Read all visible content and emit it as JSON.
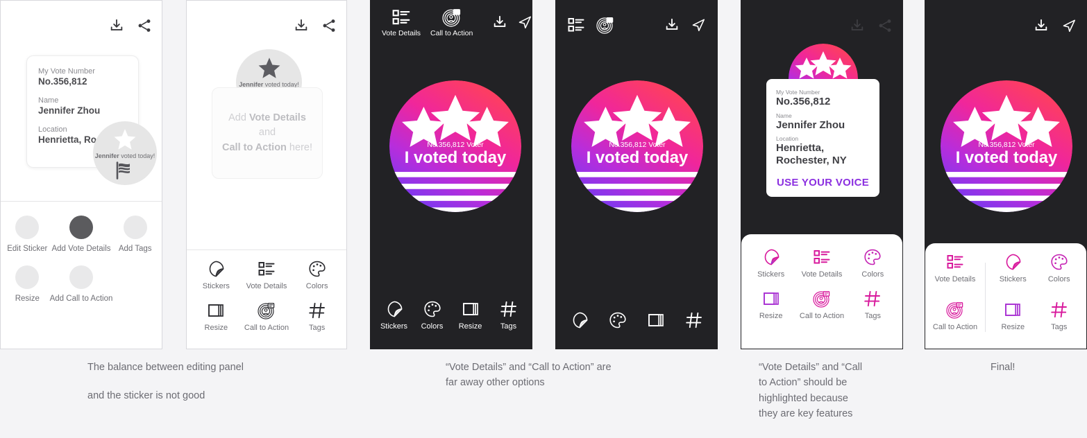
{
  "sticker": {
    "vote_line": "No.356,812 Voter",
    "headline": "I voted today",
    "small_headline": "I voted today"
  },
  "ghost_sticker": {
    "name": "Jennifer",
    "suffix": " voted today!"
  },
  "panel1": {
    "card": {
      "label_vote_number": "My Vote Number",
      "value_vote_number": "No.356,812",
      "label_name": "Name",
      "value_name": "Jennifer Zhou",
      "label_location": "Location",
      "value_location": "Henrietta, Rochester, NY"
    },
    "tools": [
      {
        "label": "Edit Sticker",
        "active": false
      },
      {
        "label": "Add Vote Details",
        "active": true
      },
      {
        "label": "Add Tags",
        "active": false
      },
      {
        "label": "Resize",
        "active": false
      },
      {
        "label": "Add Call to Action",
        "active": false
      }
    ],
    "topbar": [
      {
        "icon": "download-icon"
      },
      {
        "icon": "share-icon"
      }
    ]
  },
  "panel2": {
    "placeholder": {
      "line1_pre": "Add ",
      "line1_strong": "Vote Details",
      "line2": "and",
      "line3_strong": "Call to Action",
      "line3_post": " here!"
    },
    "tools": [
      {
        "label": "Stickers",
        "icon": "sticker-icon"
      },
      {
        "label": "Vote Details",
        "icon": "list-icon"
      },
      {
        "label": "Colors",
        "icon": "palette-icon"
      },
      {
        "label": "Resize",
        "icon": "resize-icon"
      },
      {
        "label": "Call to Action",
        "icon": "megaphone-icon"
      },
      {
        "label": "Tags",
        "icon": "hash-icon"
      }
    ]
  },
  "panel3": {
    "topbar_tools": [
      {
        "label": "Vote Details",
        "icon": "list-icon"
      },
      {
        "label": "Call to Action",
        "icon": "megaphone-icon"
      }
    ],
    "topbar_actions": [
      {
        "icon": "download-icon"
      },
      {
        "icon": "send-icon"
      }
    ],
    "tools": [
      {
        "label": "Stickers",
        "icon": "sticker-icon"
      },
      {
        "label": "Colors",
        "icon": "palette-icon"
      },
      {
        "label": "Resize",
        "icon": "resize-icon"
      },
      {
        "label": "Tags",
        "icon": "hash-icon"
      }
    ]
  },
  "panel4": {
    "topbar_tools": [
      {
        "icon": "list-icon"
      },
      {
        "icon": "megaphone-icon"
      }
    ],
    "topbar_actions": [
      {
        "icon": "download-icon"
      },
      {
        "icon": "send-icon"
      }
    ],
    "tools": [
      {
        "icon": "sticker-icon"
      },
      {
        "icon": "palette-icon"
      },
      {
        "icon": "resize-icon"
      },
      {
        "icon": "hash-icon"
      }
    ]
  },
  "panel5": {
    "card": {
      "label_vote_number": "My Vote Number",
      "value_vote_number": "No.356,812",
      "label_name": "Name",
      "value_name": "Jennifer Zhou",
      "label_location": "Location",
      "value_location_l1": "Henrietta,",
      "value_location_l2": "Rochester, NY",
      "cta": "USE YOUR VOICE",
      "cta_color": "#8b2fe0"
    },
    "tools": [
      {
        "label": "Stickers",
        "icon": "sticker-icon"
      },
      {
        "label": "Vote Details",
        "icon": "list-icon"
      },
      {
        "label": "Colors",
        "icon": "palette-icon"
      },
      {
        "label": "Resize",
        "icon": "resize-icon"
      },
      {
        "label": "Call to Action",
        "icon": "megaphone-icon"
      },
      {
        "label": "Tags",
        "icon": "hash-icon"
      }
    ]
  },
  "panel6": {
    "topbar_actions": [
      {
        "icon": "download-icon"
      },
      {
        "icon": "send-icon"
      }
    ],
    "tools_primary": [
      {
        "label": "Vote Details",
        "icon": "list-icon"
      },
      {
        "label": "Call to Action",
        "icon": "megaphone-icon"
      }
    ],
    "tools_secondary": [
      {
        "label": "Stickers",
        "icon": "sticker-icon"
      },
      {
        "label": "Colors",
        "icon": "palette-icon"
      },
      {
        "label": "Resize",
        "icon": "resize-icon"
      },
      {
        "label": "Tags",
        "icon": "hash-icon"
      }
    ]
  },
  "captions": {
    "c1_l1": "The balance between editing panel",
    "c1_l2": "and the sticker is not good",
    "c3_l1": "“Vote Details” and “Call to Action” are",
    "c3_l2": "far away other options",
    "c5_l1": "“Vote Details” and “Call",
    "c5_l2": "to Action” should be",
    "c5_l3": "highlighted because",
    "c5_l4": "they are key features",
    "c6": "Final!"
  },
  "colors": {
    "gradient_top": "#ff3d6e",
    "gradient_mid": "#d42ad0",
    "gradient_bottom": "#7b3cf0",
    "dark_bg": "#222225",
    "page_bg": "#f4f4f6"
  }
}
